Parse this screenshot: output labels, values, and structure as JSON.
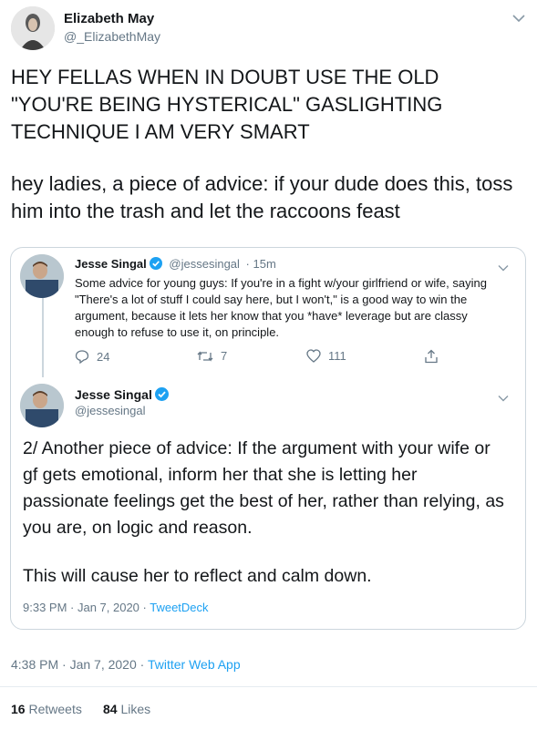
{
  "main_tweet": {
    "name": "Elizabeth May",
    "handle": "@_ElizabethMay",
    "text1": "HEY FELLAS WHEN IN DOUBT USE THE OLD \"YOU'RE BEING HYSTERICAL\" GASLIGHTING TECHNIQUE I AM VERY SMART",
    "text2": "hey ladies, a piece of advice: if your dude does this, toss him into the trash and let the raccoons feast",
    "time": "4:38 PM · Jan 7, 2020 · ",
    "client": "Twitter Web App",
    "retweets_count": "16",
    "retweets_label": "Retweets",
    "likes_count": "84",
    "likes_label": "Likes"
  },
  "quoted_thread": {
    "first": {
      "name": "Jesse Singal",
      "handle": "@jessesingal",
      "age": "· 15m",
      "text": "Some advice for young guys: If you're in a fight w/your girlfriend or wife, saying \"There's a lot of stuff I could say here, but I won't,\" is a good way to win the argument, because it lets her know that you *have* leverage but are classy enough to refuse to use it, on principle.",
      "replies": "24",
      "retweets": "7",
      "likes": "111"
    },
    "second": {
      "name": "Jesse Singal",
      "handle": "@jessesingal",
      "text1": "2/ Another piece of advice: If the argument with your wife or gf gets emotional, inform her that she is letting her passionate feelings get the best of her, rather than relying, as you are, on logic and reason.",
      "text2": "This will cause her to reflect and calm down.",
      "time": "9:33 PM · Jan 7, 2020 · ",
      "client": "TweetDeck"
    }
  },
  "colors": {
    "accent": "#1da1f2",
    "muted": "#657786",
    "border": "#ccd6dd"
  },
  "icons": [
    "chevron-down-icon",
    "verified-badge-icon",
    "reply-icon",
    "retweet-icon",
    "like-icon",
    "share-icon"
  ]
}
